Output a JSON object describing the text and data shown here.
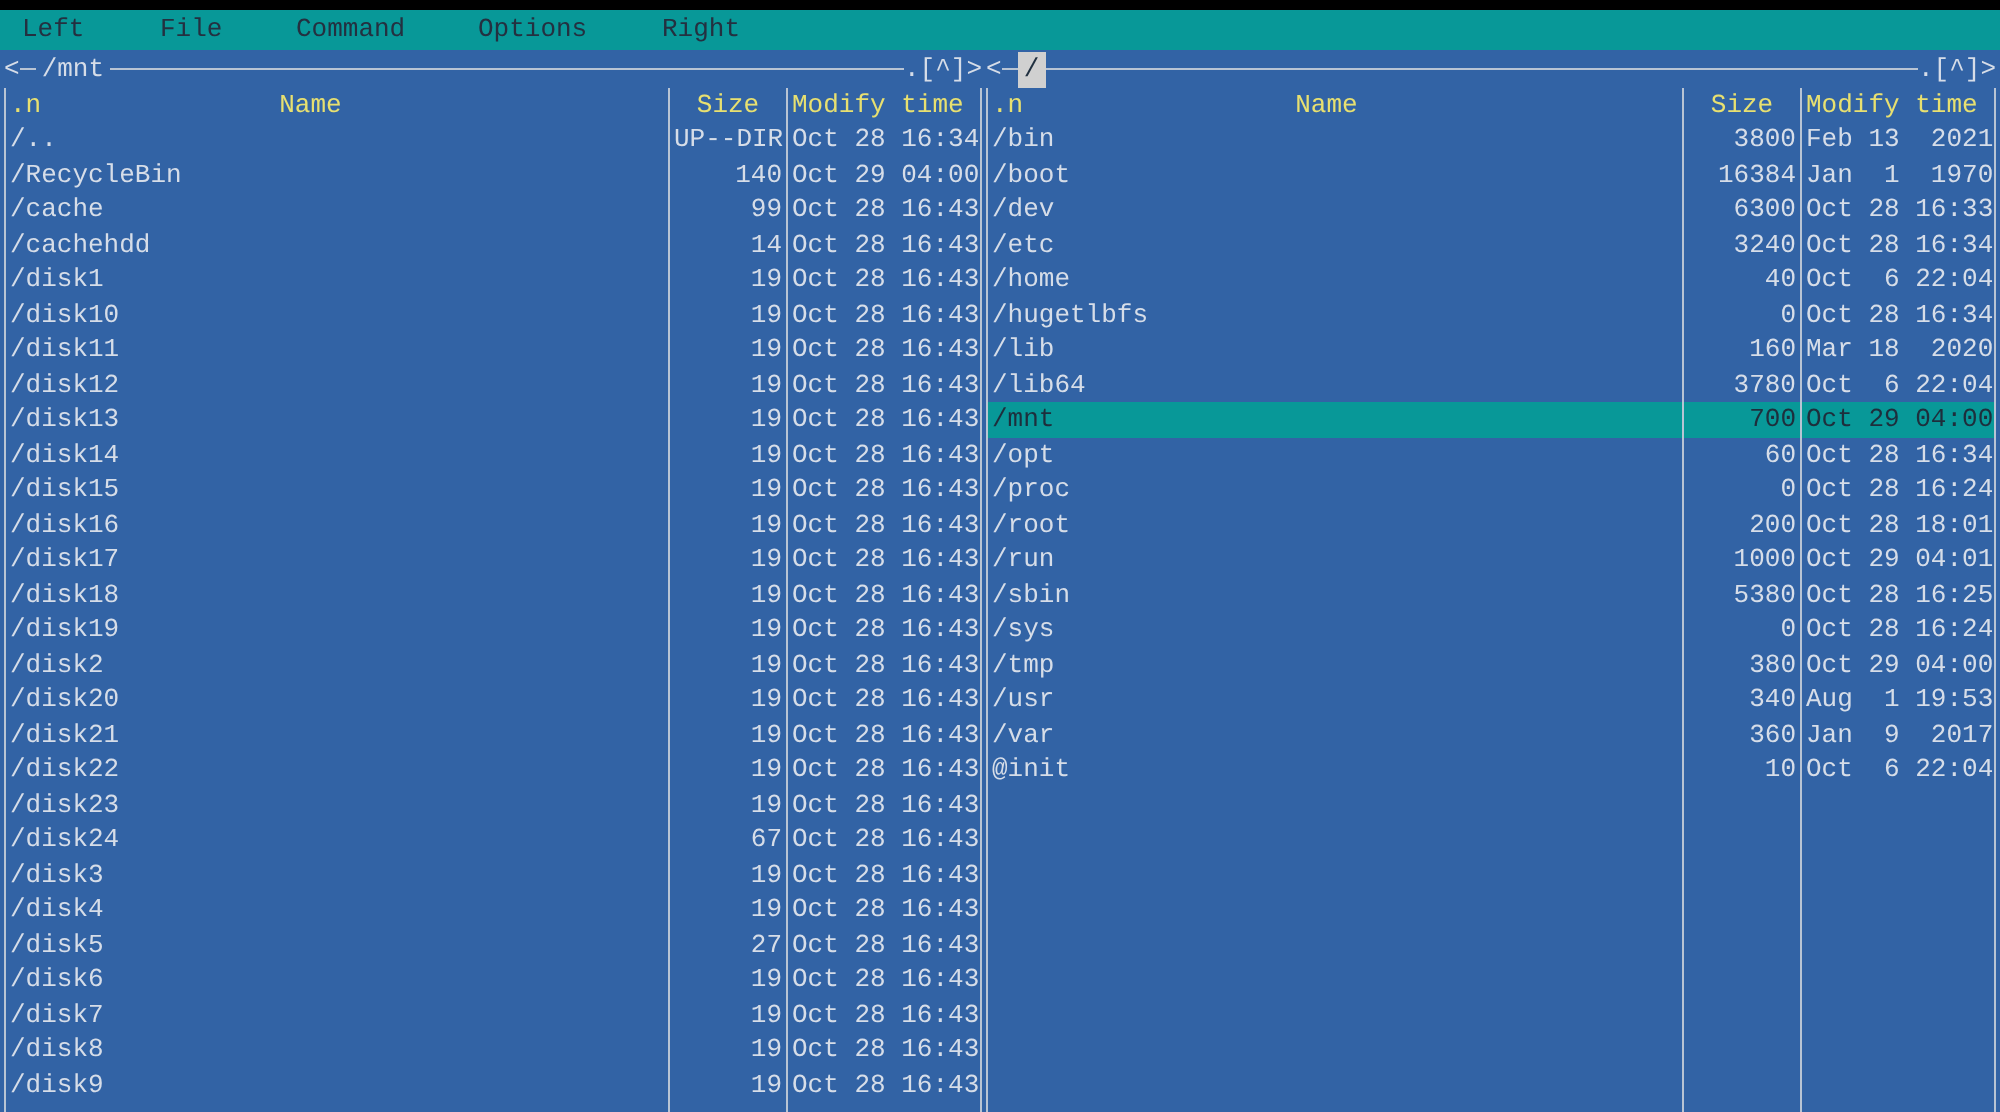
{
  "menu_bar": [
    "Left",
    "File",
    "Command",
    "Options",
    "Right"
  ],
  "panels": [
    {
      "path": "/mnt",
      "active": false,
      "nav_left": "<",
      "nav_right": ".[^]>",
      "columns": [
        ".n",
        "Name",
        "Size",
        "Modify time"
      ],
      "rows": [
        {
          "name": "/..",
          "size": "UP--DIR",
          "time": "Oct 28 16:34",
          "selected": false
        },
        {
          "name": "/RecycleBin",
          "size": "140",
          "time": "Oct 29 04:00",
          "selected": false
        },
        {
          "name": "/cache",
          "size": "99",
          "time": "Oct 28 16:43",
          "selected": false
        },
        {
          "name": "/cachehdd",
          "size": "14",
          "time": "Oct 28 16:43",
          "selected": false
        },
        {
          "name": "/disk1",
          "size": "19",
          "time": "Oct 28 16:43",
          "selected": false
        },
        {
          "name": "/disk10",
          "size": "19",
          "time": "Oct 28 16:43",
          "selected": false
        },
        {
          "name": "/disk11",
          "size": "19",
          "time": "Oct 28 16:43",
          "selected": false
        },
        {
          "name": "/disk12",
          "size": "19",
          "time": "Oct 28 16:43",
          "selected": false
        },
        {
          "name": "/disk13",
          "size": "19",
          "time": "Oct 28 16:43",
          "selected": false
        },
        {
          "name": "/disk14",
          "size": "19",
          "time": "Oct 28 16:43",
          "selected": false
        },
        {
          "name": "/disk15",
          "size": "19",
          "time": "Oct 28 16:43",
          "selected": false
        },
        {
          "name": "/disk16",
          "size": "19",
          "time": "Oct 28 16:43",
          "selected": false
        },
        {
          "name": "/disk17",
          "size": "19",
          "time": "Oct 28 16:43",
          "selected": false
        },
        {
          "name": "/disk18",
          "size": "19",
          "time": "Oct 28 16:43",
          "selected": false
        },
        {
          "name": "/disk19",
          "size": "19",
          "time": "Oct 28 16:43",
          "selected": false
        },
        {
          "name": "/disk2",
          "size": "19",
          "time": "Oct 28 16:43",
          "selected": false
        },
        {
          "name": "/disk20",
          "size": "19",
          "time": "Oct 28 16:43",
          "selected": false
        },
        {
          "name": "/disk21",
          "size": "19",
          "time": "Oct 28 16:43",
          "selected": false
        },
        {
          "name": "/disk22",
          "size": "19",
          "time": "Oct 28 16:43",
          "selected": false
        },
        {
          "name": "/disk23",
          "size": "19",
          "time": "Oct 28 16:43",
          "selected": false
        },
        {
          "name": "/disk24",
          "size": "67",
          "time": "Oct 28 16:43",
          "selected": false
        },
        {
          "name": "/disk3",
          "size": "19",
          "time": "Oct 28 16:43",
          "selected": false
        },
        {
          "name": "/disk4",
          "size": "19",
          "time": "Oct 28 16:43",
          "selected": false
        },
        {
          "name": "/disk5",
          "size": "27",
          "time": "Oct 28 16:43",
          "selected": false
        },
        {
          "name": "/disk6",
          "size": "19",
          "time": "Oct 28 16:43",
          "selected": false
        },
        {
          "name": "/disk7",
          "size": "19",
          "time": "Oct 28 16:43",
          "selected": false
        },
        {
          "name": "/disk8",
          "size": "19",
          "time": "Oct 28 16:43",
          "selected": false
        },
        {
          "name": "/disk9",
          "size": "19",
          "time": "Oct 28 16:43",
          "selected": false
        }
      ]
    },
    {
      "path": "/",
      "active": true,
      "nav_left": "<",
      "nav_right": ".[^]>",
      "columns": [
        ".n",
        "Name",
        "Size",
        "Modify time"
      ],
      "rows": [
        {
          "name": "/bin",
          "size": "3800",
          "time": "Feb 13  2021",
          "selected": false
        },
        {
          "name": "/boot",
          "size": "16384",
          "time": "Jan  1  1970",
          "selected": false
        },
        {
          "name": "/dev",
          "size": "6300",
          "time": "Oct 28 16:33",
          "selected": false
        },
        {
          "name": "/etc",
          "size": "3240",
          "time": "Oct 28 16:34",
          "selected": false
        },
        {
          "name": "/home",
          "size": "40",
          "time": "Oct  6 22:04",
          "selected": false
        },
        {
          "name": "/hugetlbfs",
          "size": "0",
          "time": "Oct 28 16:34",
          "selected": false
        },
        {
          "name": "/lib",
          "size": "160",
          "time": "Mar 18  2020",
          "selected": false
        },
        {
          "name": "/lib64",
          "size": "3780",
          "time": "Oct  6 22:04",
          "selected": false
        },
        {
          "name": "/mnt",
          "size": "700",
          "time": "Oct 29 04:00",
          "selected": true
        },
        {
          "name": "/opt",
          "size": "60",
          "time": "Oct 28 16:34",
          "selected": false
        },
        {
          "name": "/proc",
          "size": "0",
          "time": "Oct 28 16:24",
          "selected": false
        },
        {
          "name": "/root",
          "size": "200",
          "time": "Oct 28 18:01",
          "selected": false
        },
        {
          "name": "/run",
          "size": "1000",
          "time": "Oct 29 04:01",
          "selected": false
        },
        {
          "name": "/sbin",
          "size": "5380",
          "time": "Oct 28 16:25",
          "selected": false
        },
        {
          "name": "/sys",
          "size": "0",
          "time": "Oct 28 16:24",
          "selected": false
        },
        {
          "name": "/tmp",
          "size": "380",
          "time": "Oct 29 04:00",
          "selected": false
        },
        {
          "name": "/usr",
          "size": "340",
          "time": "Aug  1 19:53",
          "selected": false
        },
        {
          "name": "/var",
          "size": "360",
          "time": "Jan  9  2017",
          "selected": false
        },
        {
          "name": "@init",
          "size": "10",
          "time": "Oct  6 22:04",
          "selected": false
        }
      ]
    }
  ]
}
